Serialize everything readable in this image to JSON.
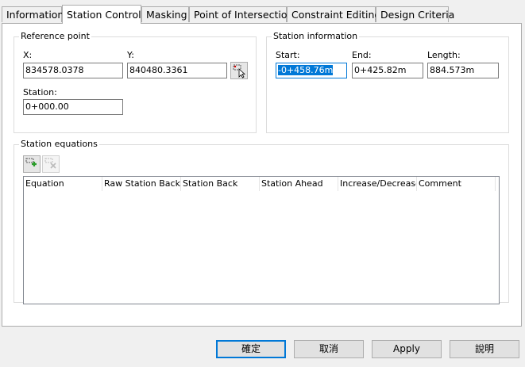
{
  "tabs": [
    {
      "label": "Information"
    },
    {
      "label": "Station Control"
    },
    {
      "label": "Masking"
    },
    {
      "label": "Point of Intersection"
    },
    {
      "label": "Constraint Editing"
    },
    {
      "label": "Design Criteria"
    }
  ],
  "active_tab": "Station Control",
  "reference_point": {
    "title": "Reference point",
    "x_label": "X:",
    "x_value": "834578.0378",
    "y_label": "Y:",
    "y_value": "840480.3361",
    "station_label": "Station:",
    "station_value": "0+000.00"
  },
  "station_information": {
    "title": "Station information",
    "start_label": "Start:",
    "start_value": "-0+458.76m",
    "end_label": "End:",
    "end_value": "0+425.82m",
    "length_label": "Length:",
    "length_value": "884.573m"
  },
  "station_equations": {
    "title": "Station equations",
    "columns": [
      "Equation",
      "Raw Station Back",
      "Station Back",
      "Station Ahead",
      "Increase/Decrease",
      "Comment"
    ],
    "rows": []
  },
  "buttons": {
    "ok": "確定",
    "cancel": "取消",
    "apply": "Apply",
    "help": "說明"
  }
}
